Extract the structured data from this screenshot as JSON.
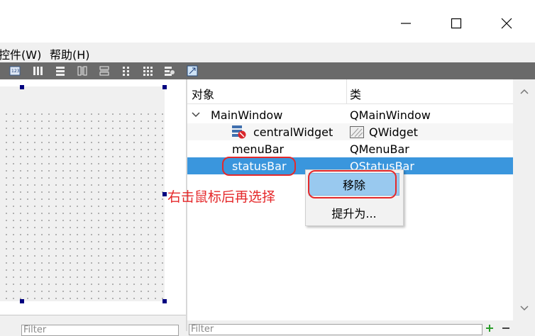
{
  "menubar": {
    "items": [
      "控件(W)",
      "帮助(H)"
    ]
  },
  "object_inspector": {
    "headers": {
      "object": "对象",
      "class": "类"
    },
    "rows": [
      {
        "object": "MainWindow",
        "class": "QMainWindow"
      },
      {
        "object": "centralWidget",
        "class": "QWidget"
      },
      {
        "object": "menuBar",
        "class": "QMenuBar"
      },
      {
        "object": "statusBar",
        "class": "QStatusBar"
      }
    ]
  },
  "context_menu": {
    "items": [
      "移除",
      "提升为..."
    ]
  },
  "annotation": {
    "text": "右击鼠标后再选择",
    "color": "#e5292b"
  },
  "filters": {
    "left_placeholder": "Filter",
    "right_placeholder": "Filter"
  },
  "colors": {
    "selection": "#3a96dd",
    "menu_highlight": "#99c9ef",
    "annotation": "#e5292b"
  }
}
